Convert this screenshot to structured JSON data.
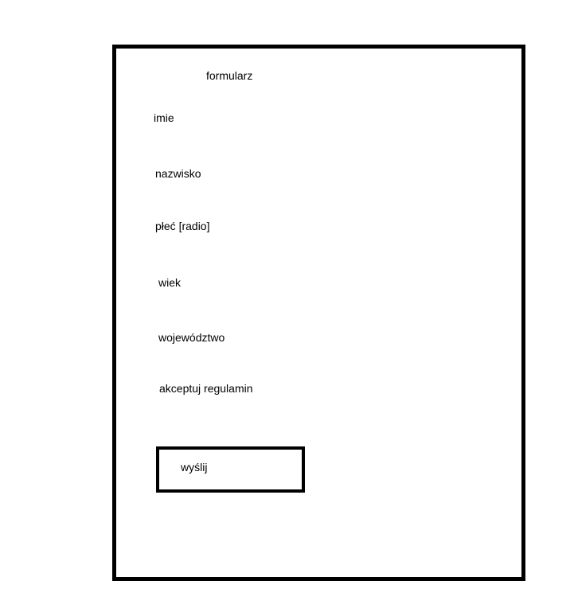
{
  "form": {
    "title": "formularz",
    "fields": [
      {
        "label": "imie"
      },
      {
        "label": "nazwisko"
      },
      {
        "label": "płeć [radio]"
      },
      {
        "label": "wiek"
      },
      {
        "label": "województwo"
      },
      {
        "label": "akceptuj regulamin"
      }
    ],
    "submit_label": "wyślij"
  }
}
